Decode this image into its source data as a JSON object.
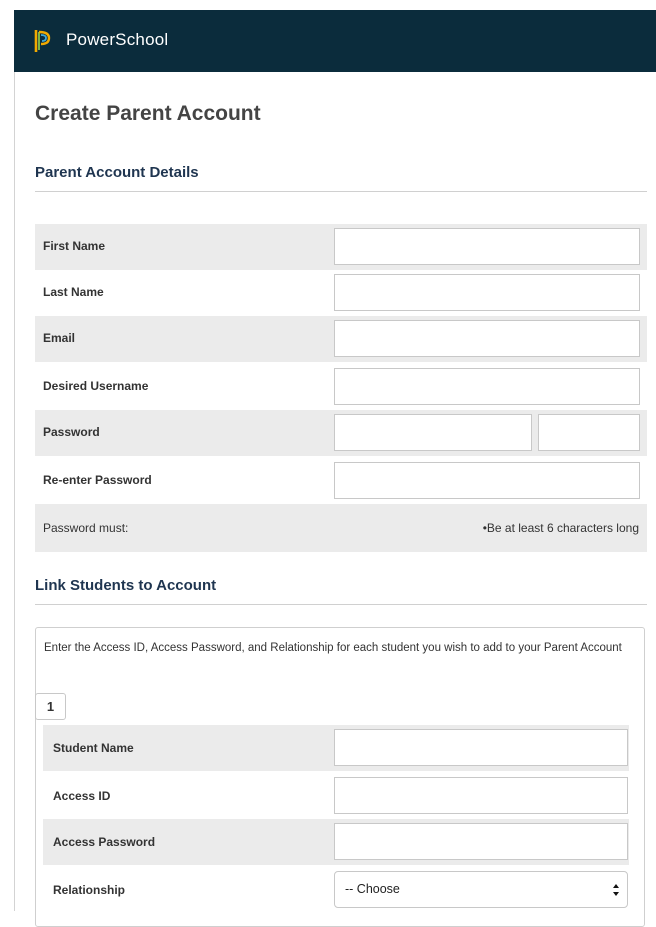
{
  "header": {
    "brand": "PowerSchool",
    "logo_icon": "powerschool-logo-icon"
  },
  "page": {
    "title": "Create Parent Account"
  },
  "parent_section": {
    "title": "Parent Account Details",
    "fields": {
      "first_name": {
        "label": "First Name",
        "value": ""
      },
      "last_name": {
        "label": "Last Name",
        "value": ""
      },
      "email": {
        "label": "Email",
        "value": ""
      },
      "username": {
        "label": "Desired Username",
        "value": ""
      },
      "password": {
        "label": "Password",
        "value": ""
      },
      "reenter_password": {
        "label": "Re-enter Password",
        "value": ""
      }
    },
    "password_rules": {
      "label": "Password must:",
      "rule": "•Be at least 6 characters long"
    }
  },
  "students_section": {
    "title": "Link Students to Account",
    "instructions": "Enter the Access ID, Access Password, and Relationship for each student you wish to add to your Parent Account",
    "student_tab": "1",
    "fields": {
      "student_name": {
        "label": "Student Name",
        "value": ""
      },
      "access_id": {
        "label": "Access ID",
        "value": ""
      },
      "access_password": {
        "label": "Access Password",
        "value": ""
      },
      "relationship": {
        "label": "Relationship",
        "selected": "-- Choose"
      }
    }
  },
  "colors": {
    "header_bg": "#0b2c3c",
    "section_title": "#1f3550",
    "row_shade": "#ebebeb"
  }
}
